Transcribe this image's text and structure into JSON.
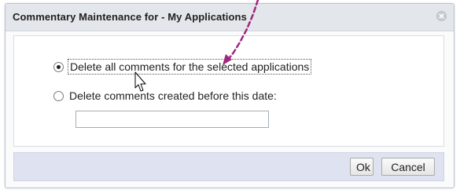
{
  "dialog": {
    "title": "Commentary Maintenance for - My Applications",
    "options": [
      {
        "label": "Delete all comments for the selected applications",
        "selected": true
      },
      {
        "label": "Delete comments created before this date:",
        "selected": false
      }
    ],
    "date_input": {
      "value": "",
      "placeholder": ""
    },
    "buttons": {
      "ok": "Ok",
      "cancel": "Cancel"
    }
  },
  "icons": {
    "close": "close-icon",
    "cursor": "mouse-pointer-icon",
    "annotation": "annotation-arrow-icon"
  },
  "colors": {
    "annotation_arrow": "#a0267f",
    "footer_bg": "#dfe3f1",
    "title_bg": "#e3e6ea"
  }
}
